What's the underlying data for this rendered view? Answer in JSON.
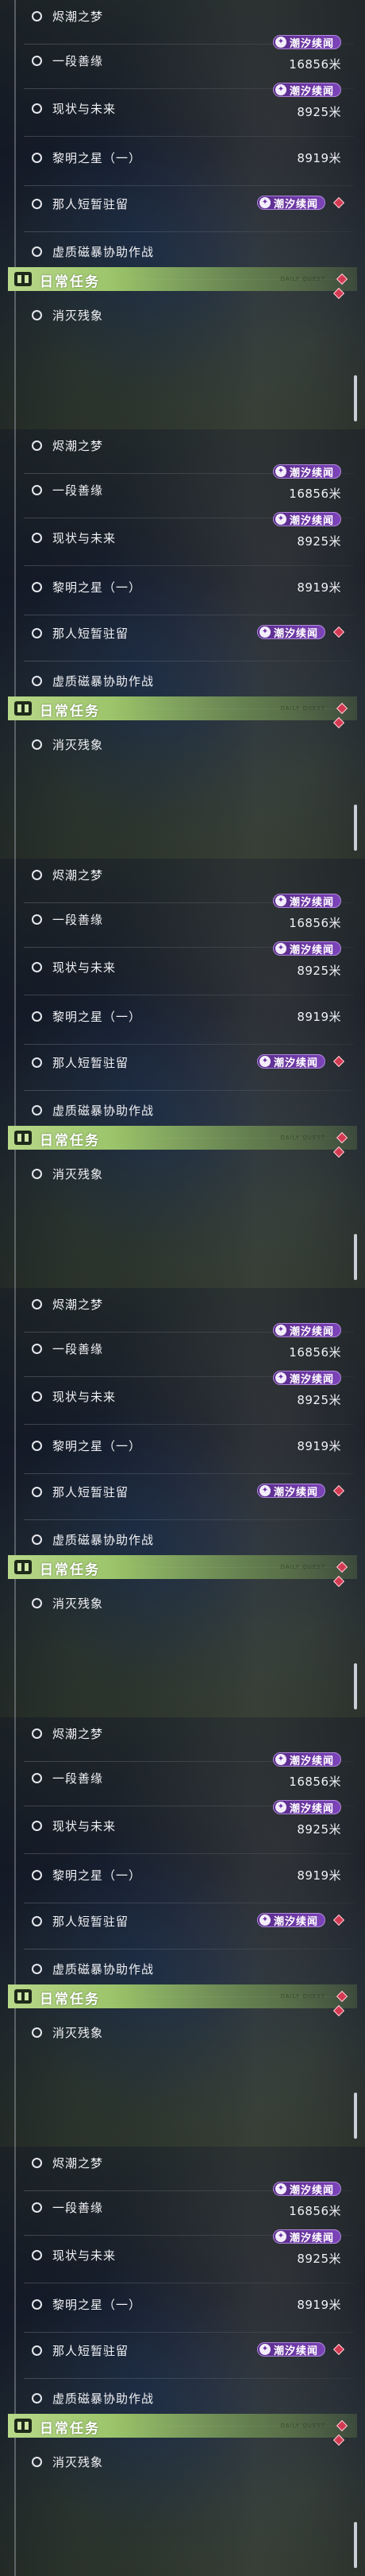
{
  "quests": [
    {
      "title": "烬潮之梦",
      "distance": "",
      "tag": ""
    },
    {
      "title": "一段善缘",
      "distance": "16856米",
      "tag": "潮汐续闻"
    },
    {
      "title": "现状与未来",
      "distance": "8925米",
      "tag": "潮汐续闻"
    },
    {
      "title": "黎明之星（一）",
      "distance": "8919米",
      "tag": ""
    },
    {
      "title": "那人短暂驻留",
      "distance": "",
      "tag": "潮汐续闻",
      "tracked": true
    },
    {
      "title": "虚质磁暴协助作战",
      "distance": "",
      "tag": ""
    }
  ],
  "daily": {
    "header": "日常任务",
    "small_text": "DAILY QUEST",
    "items": [
      {
        "title": "消灭残象"
      }
    ]
  },
  "colors": {
    "tag": "#6a34a4",
    "marker": "#d23a52",
    "daily_header": "#a6cc74"
  },
  "icons": {
    "radio": "circle-outline-icon",
    "tag": "tidal-icon",
    "marker": "diamond-marker-icon",
    "daily": "book-icon"
  }
}
